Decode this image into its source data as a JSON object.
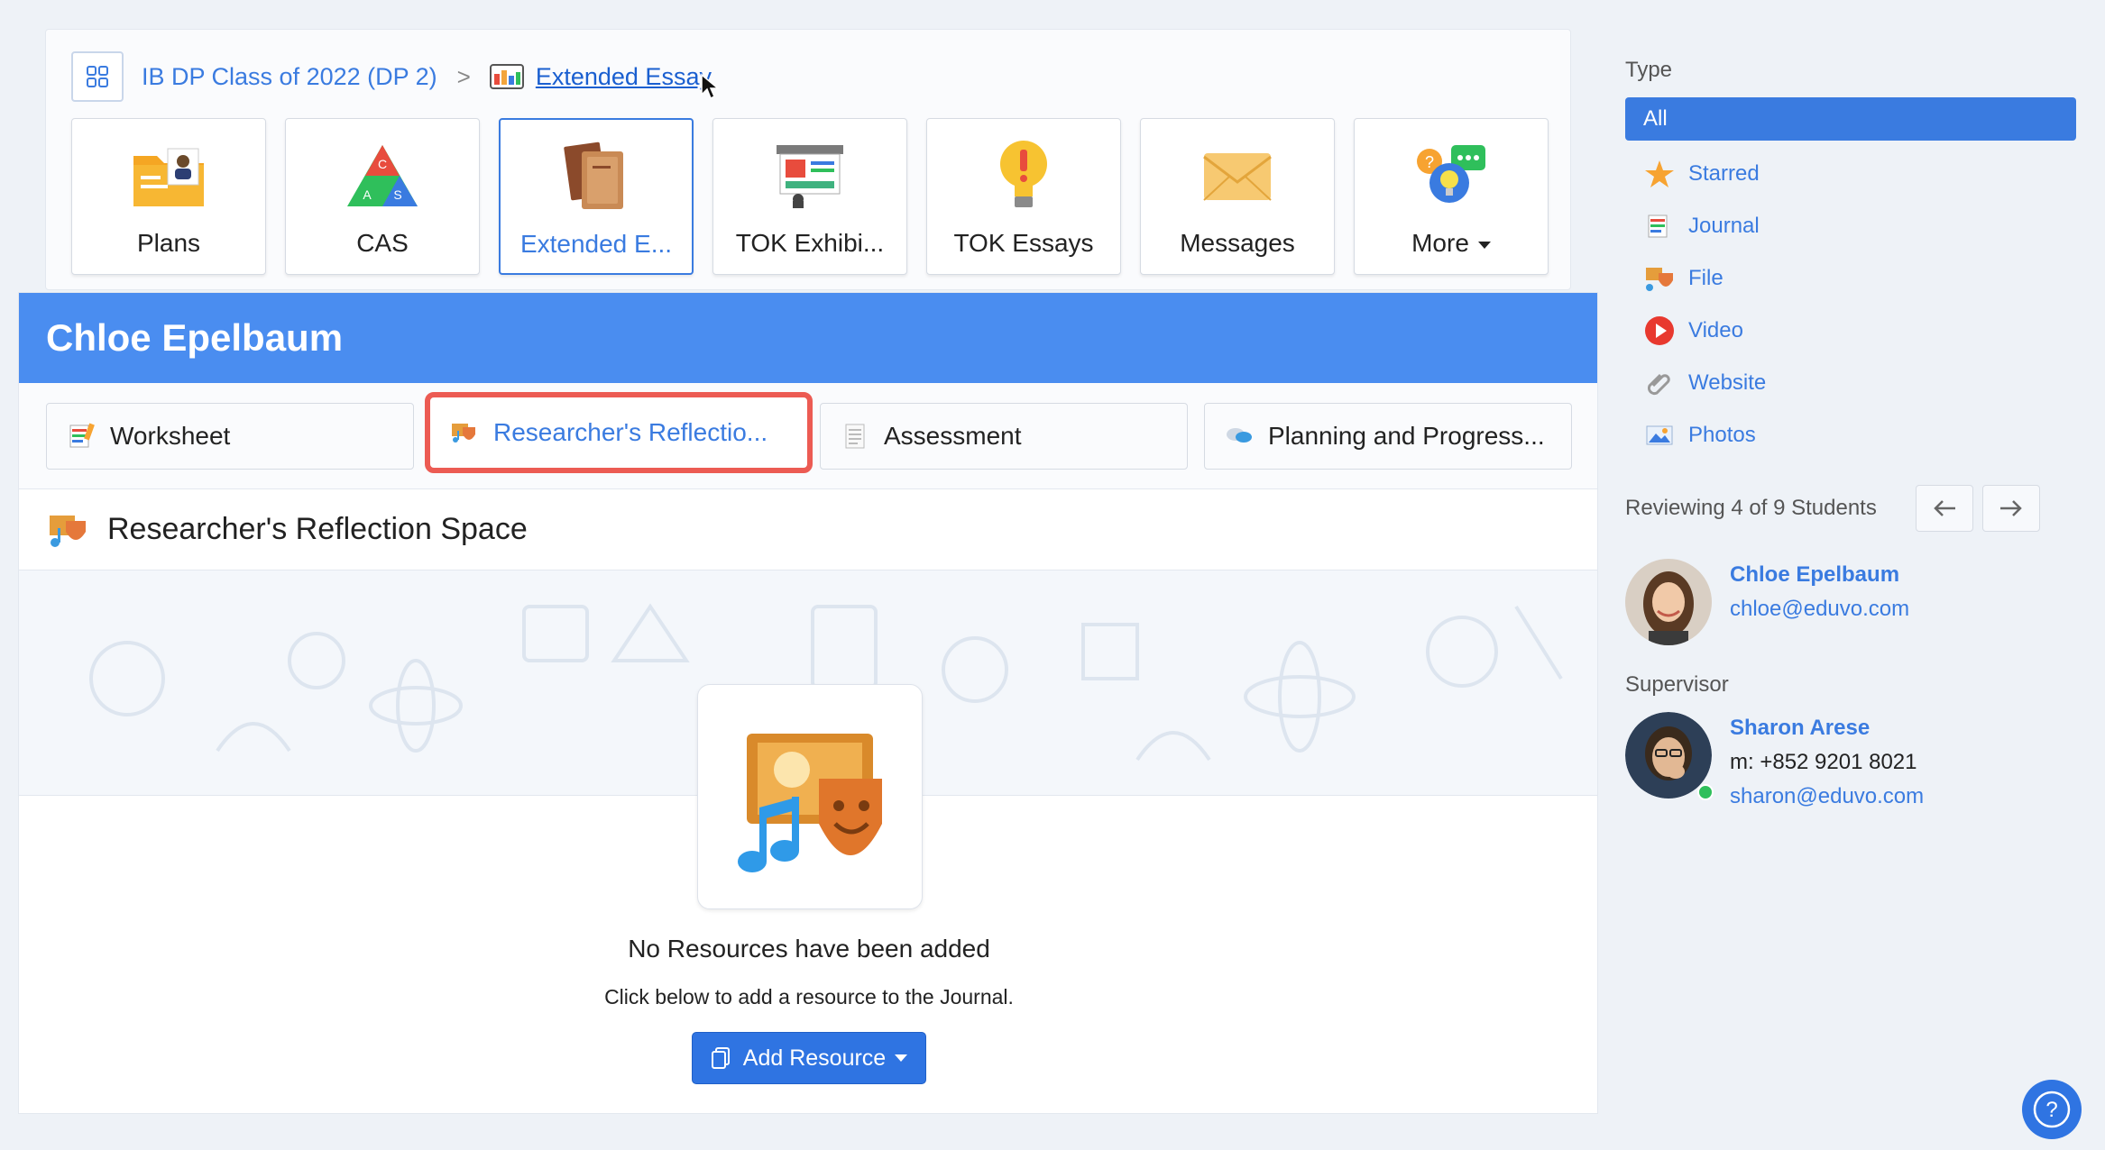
{
  "breadcrumb": {
    "class_name": "IB DP Class of 2022 (DP 2)",
    "separator": ">",
    "current": "Extended Essay"
  },
  "tiles": [
    {
      "label": "Plans",
      "icon": "folder-plans-icon"
    },
    {
      "label": "CAS",
      "icon": "cas-triangle-icon"
    },
    {
      "label": "Extended E...",
      "icon": "books-icon",
      "active": true
    },
    {
      "label": "TOK Exhibi...",
      "icon": "exhibition-icon"
    },
    {
      "label": "TOK Essays",
      "icon": "lightbulb-icon"
    },
    {
      "label": "Messages",
      "icon": "envelope-icon"
    },
    {
      "label": "More",
      "icon": "more-bubbles-icon"
    }
  ],
  "student": {
    "name": "Chloe Epelbaum"
  },
  "tabs": [
    {
      "label": "Worksheet",
      "icon": "journal-icon"
    },
    {
      "label": "Researcher's Reflectio...",
      "icon": "theater-masks-icon",
      "selected": true
    },
    {
      "label": "Assessment",
      "icon": "document-icon"
    },
    {
      "label": "Planning and Progress...",
      "icon": "chat-bubbles-icon"
    }
  ],
  "section": {
    "title": "Researcher's Reflection Space",
    "empty_title": "No Resources have been added",
    "empty_subtitle": "Click below to add a resource to the Journal.",
    "add_button": "Add Resource"
  },
  "sidebar": {
    "type_title": "Type",
    "types": [
      {
        "label": "All",
        "icon": "",
        "active": true
      },
      {
        "label": "Starred",
        "icon": "star-icon"
      },
      {
        "label": "Journal",
        "icon": "journal-icon"
      },
      {
        "label": "File",
        "icon": "file-media-icon"
      },
      {
        "label": "Video",
        "icon": "play-icon"
      },
      {
        "label": "Website",
        "icon": "paperclip-icon"
      },
      {
        "label": "Photos",
        "icon": "photo-icon"
      }
    ],
    "reviewing": "Reviewing 4 of 9 Students",
    "student": {
      "name": "Chloe Epelbaum",
      "email": "chloe@eduvo.com"
    },
    "supervisor_title": "Supervisor",
    "supervisor": {
      "name": "Sharon Arese",
      "phone": "m: +852 9201 8021",
      "email": "sharon@eduvo.com"
    }
  },
  "colors": {
    "accent": "#3a7be0",
    "banner": "#4a8df0",
    "highlight": "#ec5b53"
  }
}
